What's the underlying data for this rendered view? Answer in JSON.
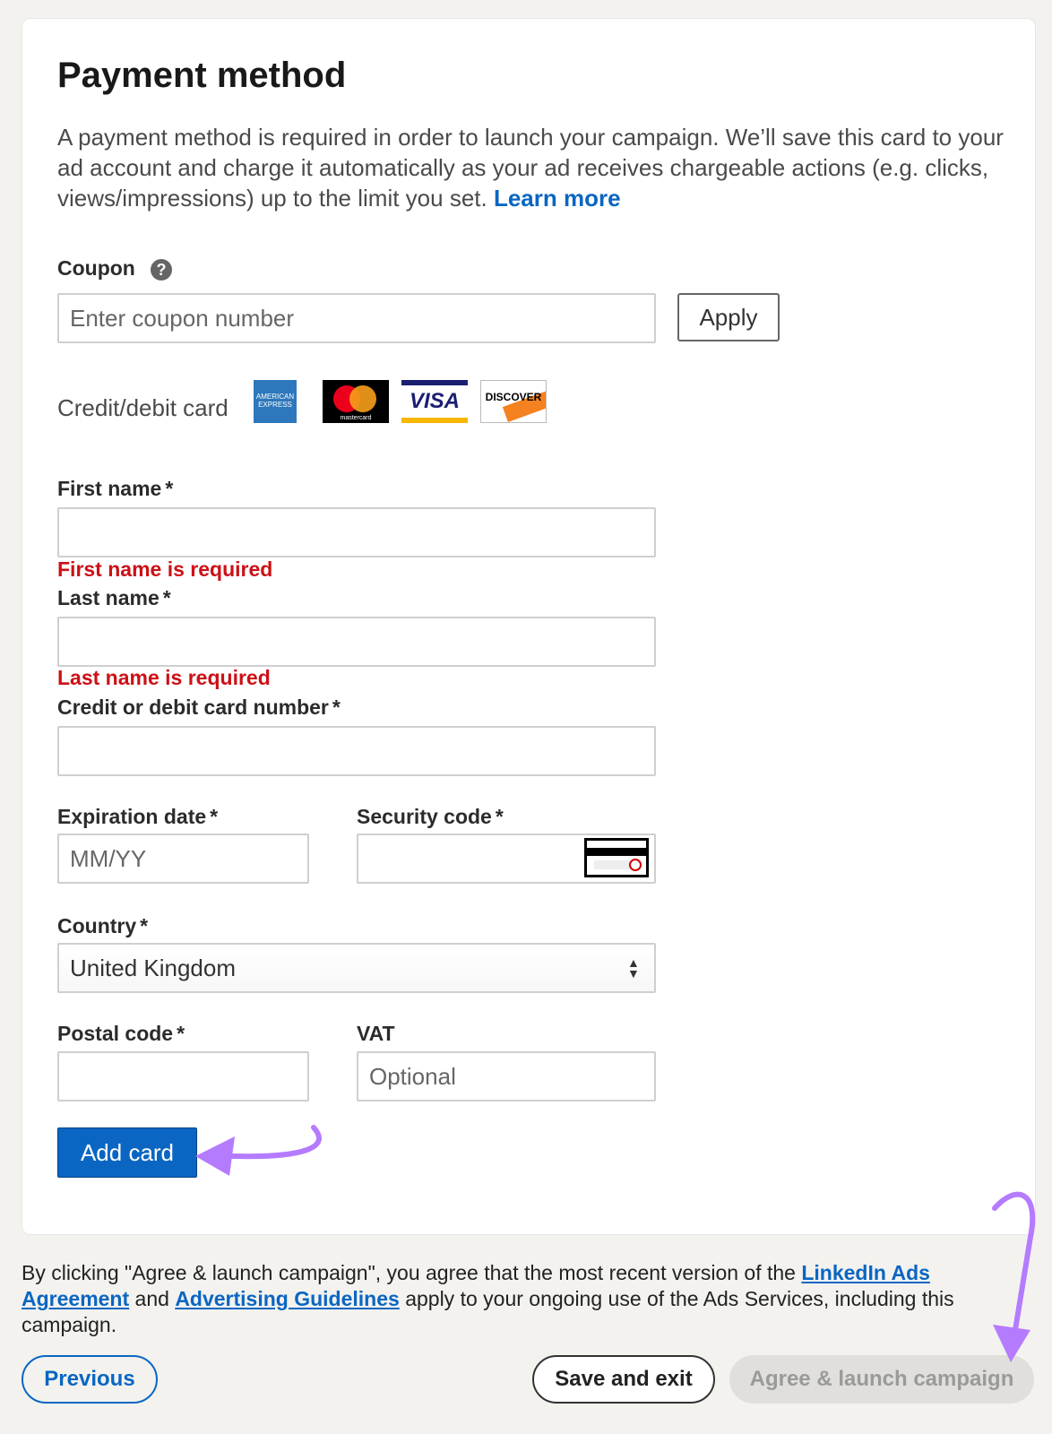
{
  "section": {
    "title": "Payment method",
    "description": "A payment method is required in order to launch your campaign. We’ll save this card to your ad account and charge it automatically as your ad receives chargeable actions (e.g. clicks, views/impressions) up to the limit you set.",
    "learn_more": "Learn more"
  },
  "coupon": {
    "label": "Coupon",
    "help_glyph": "?",
    "placeholder": "Enter coupon number",
    "apply_label": "Apply"
  },
  "card_types": {
    "label": "Credit/debit card",
    "brands": {
      "amex": "AMERICAN EXPRESS",
      "mastercard": "mastercard",
      "visa": "VISA",
      "discover": "DISCOVER"
    }
  },
  "form": {
    "required_marker": "*",
    "first_name": {
      "label": "First name",
      "value": "",
      "error": "First name is required"
    },
    "last_name": {
      "label": "Last name",
      "value": "",
      "error": "Last name is required"
    },
    "card_number": {
      "label": "Credit or debit card number",
      "value": ""
    },
    "expiration": {
      "label": "Expiration date",
      "placeholder": "MM/YY"
    },
    "security_code": {
      "label": "Security code",
      "value": ""
    },
    "country": {
      "label": "Country",
      "selected": "United Kingdom"
    },
    "postal_code": {
      "label": "Postal code",
      "value": ""
    },
    "vat": {
      "label": "VAT",
      "placeholder": "Optional"
    },
    "add_card_label": "Add card"
  },
  "legal": {
    "text_1": "By clicking \"Agree & launch campaign\", you agree that the most recent version of the ",
    "link_1": "LinkedIn Ads Agreement",
    "text_2": " and ",
    "link_2": "Advertising Guidelines",
    "text_3": " apply to your ongoing use of the Ads Services, including this campaign."
  },
  "footer": {
    "previous_label": "Previous",
    "save_exit_label": "Save and exit",
    "launch_label": "Agree & launch campaign"
  },
  "colors": {
    "accent": "#0a66c2",
    "error": "#cc1016",
    "annotation_arrow": "#b57bff",
    "page_bg": "#f3f2ef"
  }
}
